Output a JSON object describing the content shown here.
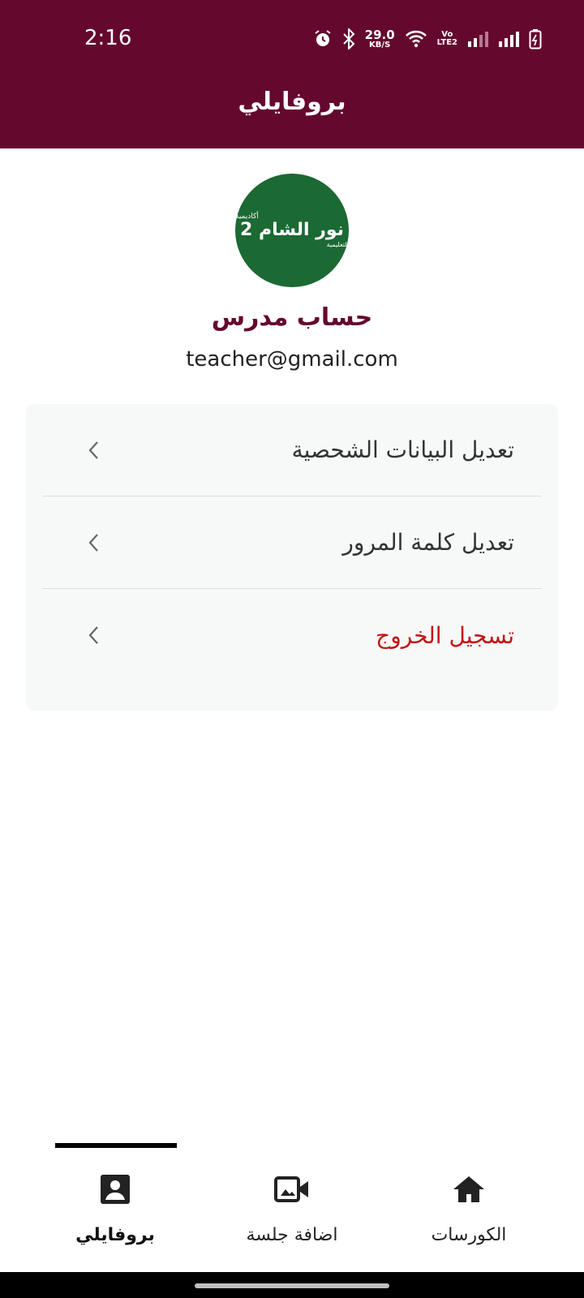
{
  "status_bar": {
    "time": "2:16",
    "net_speed_value": "29.0",
    "net_speed_unit": "KB/S",
    "volte_top": "Vo",
    "volte_bottom": "LTE2",
    "icons": [
      "alarm-icon",
      "bluetooth-icon",
      "wifi-icon",
      "signal-icon",
      "signal-icon",
      "battery-icon"
    ]
  },
  "header": {
    "title": "بروفايلي"
  },
  "profile": {
    "logo_line1": "أكاديمية",
    "logo_line2": "نور الشام 2",
    "logo_line3": "التعليمية",
    "name": "حساب مدرس",
    "email": "teacher@gmail.com"
  },
  "menu": {
    "items": [
      {
        "label": "تعديل البيانات الشحصية"
      },
      {
        "label": "تعديل كلمة المرور"
      },
      {
        "label": "تسجيل الخروج"
      }
    ]
  },
  "bottom_nav": {
    "items": [
      {
        "label": "بروفايلي",
        "icon": "profile-icon",
        "active": true
      },
      {
        "label": "اضافة جلسة",
        "icon": "video-add-icon",
        "active": false
      },
      {
        "label": "الكورسات",
        "icon": "home-icon",
        "active": false
      }
    ]
  },
  "colors": {
    "header": "#65082e",
    "accent": "#65082e",
    "avatar": "#1b6933",
    "logout": "#c21616",
    "card": "#f7f8f8"
  }
}
